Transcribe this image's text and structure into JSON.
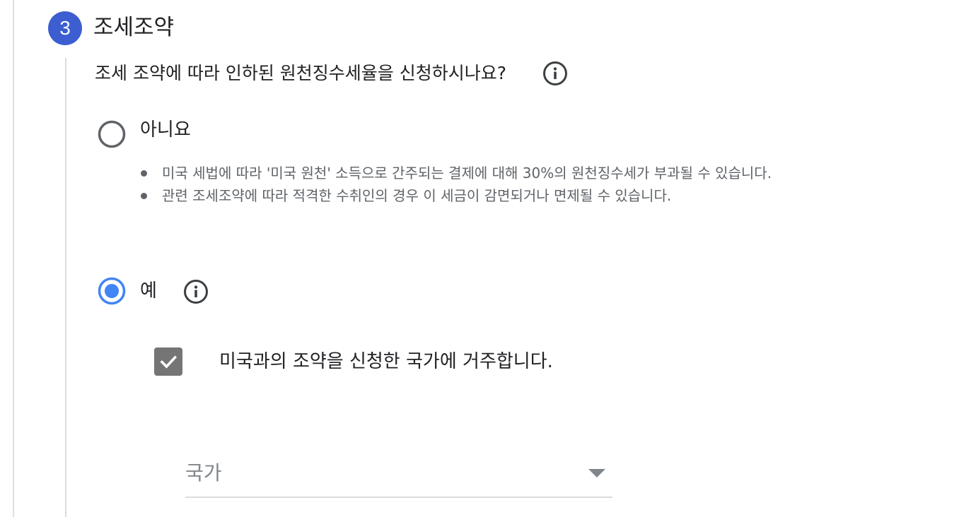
{
  "step": {
    "number": "3",
    "title": "조세조약"
  },
  "question": {
    "text": "조세 조약에 따라 인하된 원천징수세율을 신청하시나요?",
    "info_icon": "info-icon"
  },
  "options": {
    "no": {
      "label": "아니요",
      "selected": false,
      "bullets": [
        "미국 세법에 따라 '미국 원천' 소득으로 간주되는 결제에 대해 30%의 원천징수세가 부과될 수 있습니다.",
        "관련 조세조약에 따라 적격한 수취인의 경우 이 세금이 감면되거나 면제될 수 있습니다."
      ]
    },
    "yes": {
      "label": "예",
      "selected": true,
      "info_icon": "info-icon"
    }
  },
  "residence_checkbox": {
    "label": "미국과의 조약을 신청한 국가에 거주합니다.",
    "checked": true
  },
  "country_select": {
    "placeholder": "국가",
    "icon": "dropdown-arrow-icon"
  },
  "colors": {
    "accent": "#3c5ed1",
    "radio_selected": "#4285f4",
    "radio_unselected": "#5f6368",
    "checkbox_fill": "#757575",
    "secondary_text": "#5f6368",
    "placeholder_text": "#80868b",
    "rail": "#dadce0"
  }
}
